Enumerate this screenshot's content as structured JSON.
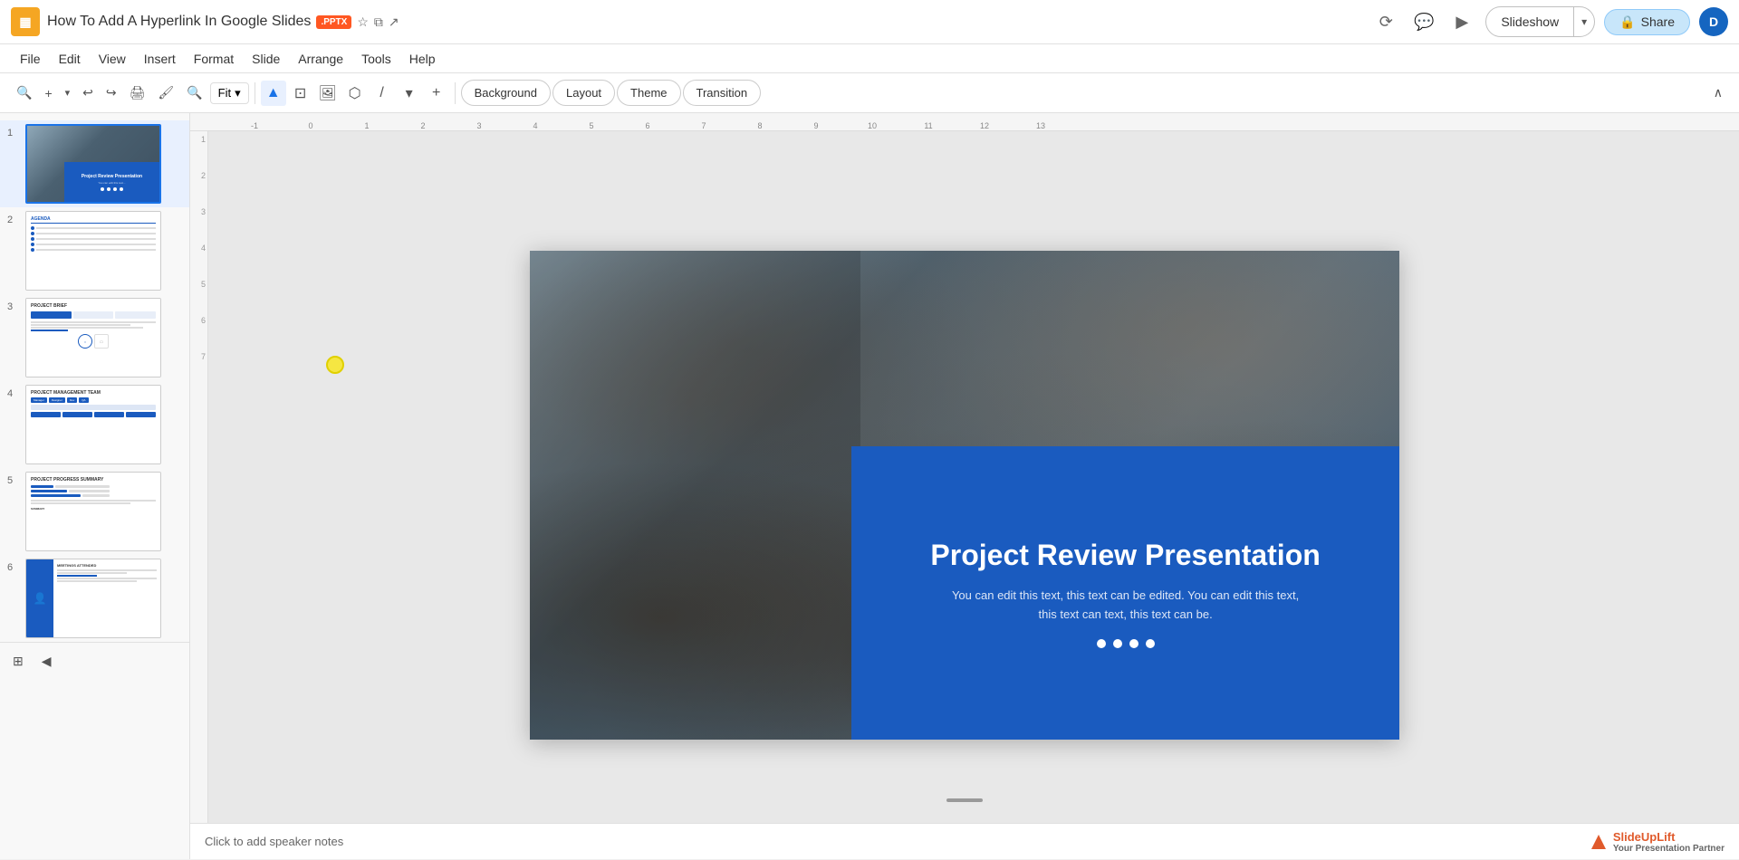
{
  "titlebar": {
    "app_icon": "▦",
    "doc_title": "How To Add A Hyperlink In Google Slides",
    "badge": ".PPTX",
    "star_icon": "★",
    "folder_icon": "⧉",
    "history_icon": "◷",
    "slideshow_label": "Slideshow",
    "share_label": "Share",
    "user_initial": "D"
  },
  "menubar": {
    "items": [
      "File",
      "Edit",
      "View",
      "Insert",
      "Format",
      "Slide",
      "Arrange",
      "Tools",
      "Help"
    ]
  },
  "toolbar": {
    "zoom_label": "Fit",
    "background_label": "Background",
    "layout_label": "Layout",
    "theme_label": "Theme",
    "transition_label": "Transition"
  },
  "slides": [
    {
      "number": "1",
      "title": "Project Review Presentation",
      "active": true
    },
    {
      "number": "2",
      "title": "Agenda"
    },
    {
      "number": "3",
      "title": "Project Brief"
    },
    {
      "number": "4",
      "title": "Project Management Team"
    },
    {
      "number": "5",
      "title": "Project Progress Summary"
    },
    {
      "number": "6",
      "title": "Meetings Attended"
    }
  ],
  "main_slide": {
    "title": "Project Review Presentation",
    "subtitle_line1": "You can edit this text, this text can be edited. You can edit this text,",
    "subtitle_line2": "this text can text, this text can be."
  },
  "ruler": {
    "marks": [
      "-1",
      "0",
      "1",
      "2",
      "3",
      "4",
      "5",
      "6",
      "7",
      "8",
      "9",
      "10",
      "11",
      "12",
      "13"
    ]
  },
  "bottom": {
    "speaker_notes": "Click to add speaker notes",
    "logo_text": "SlideUpLift",
    "logo_tagline": "Your Presentation Partner"
  }
}
